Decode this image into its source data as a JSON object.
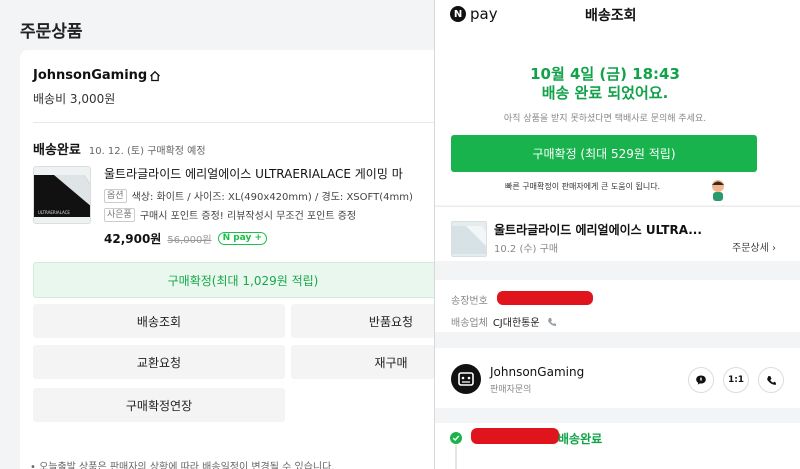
{
  "order_page": {
    "title": "주문상품",
    "seller": "JohnsonGaming",
    "shipping_fee": "배송비 3,000원",
    "status": "배송완료",
    "status_sub": "10. 12. (토) 구매확정 예정",
    "product_thumb_text": "ULTRAERIALACE",
    "product_name": "울트라글라이드 에리얼에이스 ULTRAERIALACE 게이밍 마",
    "option_tag": "옵션",
    "option_text": "색상: 화이트 / 사이즈: XL(490x420mm) / 경도: XSOFT(4mm)",
    "benefit_tag": "사은품",
    "benefit_text": "구매시 포인트 증정! 리뷰작성시 무조건 포인트 증정",
    "price": "42,900원",
    "original_price": "56,000원",
    "npay_badge": "N pay +",
    "confirm_label": "구매확정(최대 1,029원 적립)",
    "btn_tracking": "배송조회",
    "btn_return": "반품요청",
    "btn_exchange": "교환요청",
    "btn_repurchase": "재구매",
    "btn_extend": "구매확정연장",
    "notice": "• 오늘출발 상품은 판매자의 상황에 따라 배송일정이 변경될 수 있습니다."
  },
  "panel": {
    "logo_n": "N",
    "logo_pay": "pay",
    "title": "배송조회",
    "delivered_date": "10월 4일 (금) 18:43",
    "delivered_msg": "배송 완료 되었어요.",
    "hint": "아직 상품을 받지 못하셨다면 택배사로 문의해 주세요.",
    "confirm_label": "구매확정 (최대 529원 적립)",
    "fast_note": "빠른 구매확정이 판매자에게 큰 도움이 됩니다.",
    "product_name": "울트라글라이드 에리얼에이스 ULTRA...",
    "product_date": "10.2 (수) 구매",
    "detail_link": "주문상세 ›",
    "tracking_label": "송장번호",
    "carrier_label": "배송업체",
    "carrier_value": "CJ대한통운",
    "seller_name": "JohnsonGaming",
    "seller_sub": "판매자문의",
    "btn_talk_icon": "chat-icon",
    "btn_one_to_one": "1:1",
    "btn_call_icon": "phone-icon",
    "timeline_label": "배송완료",
    "accent_green": "#12a24a",
    "button_green": "#18b34c",
    "redaction_red": "#e0141c"
  }
}
